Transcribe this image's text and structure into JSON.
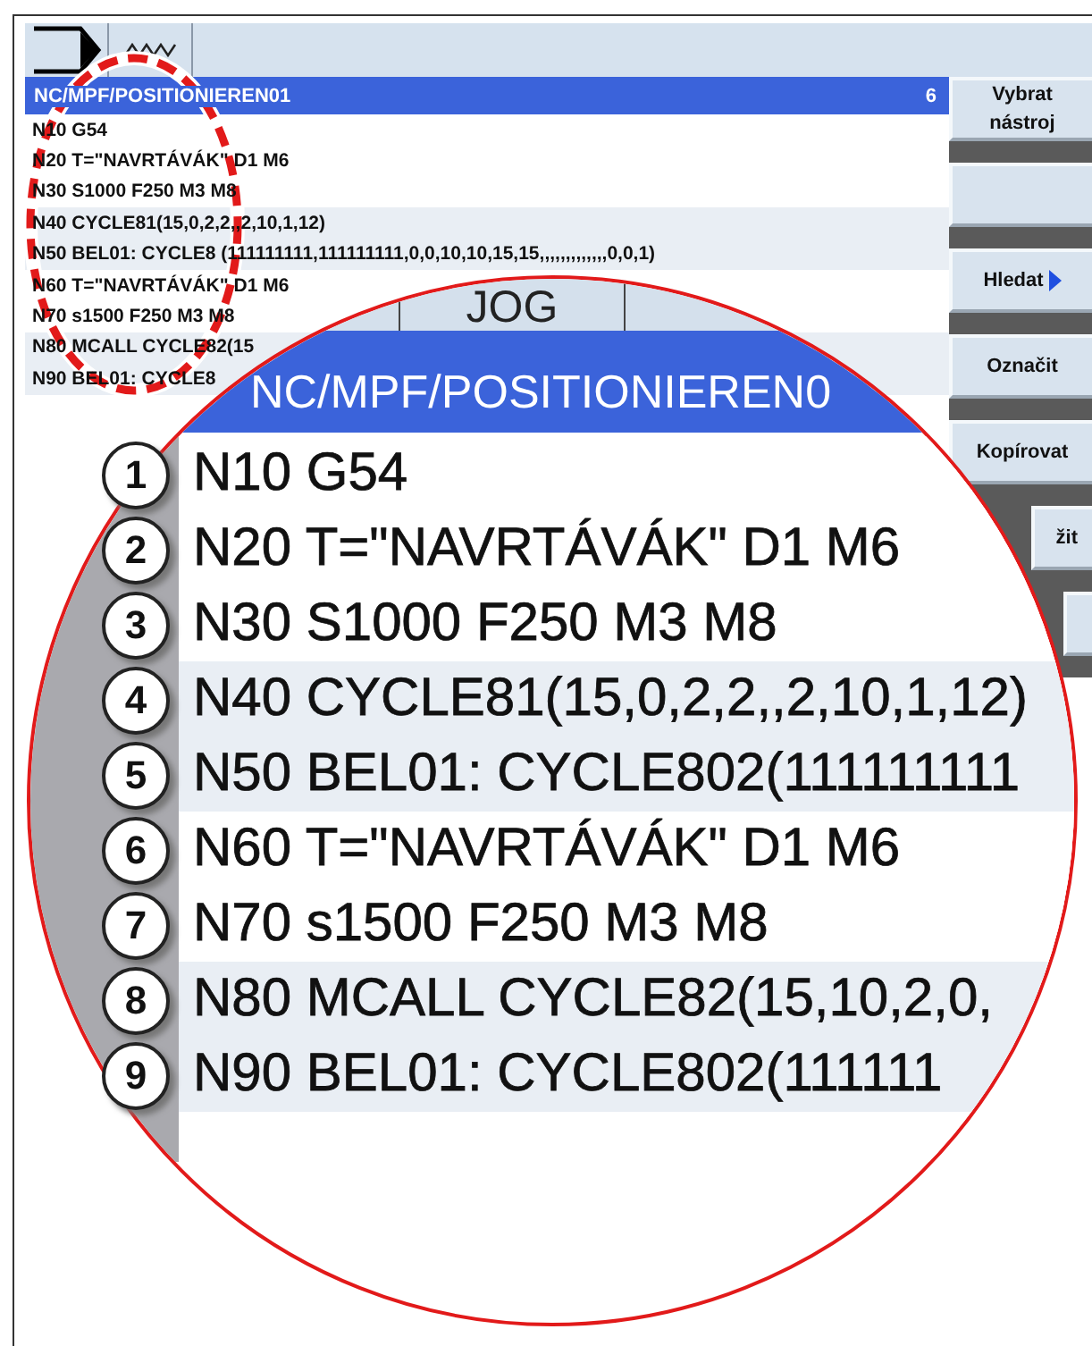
{
  "editor": {
    "title": "NC/MPF/POSITIONIEREN01",
    "line_count": "6",
    "lines": [
      "N10 G54",
      "N20 T=\"NAVRTÁVÁK\" D1 M6",
      "N30 S1000 F250 M3 M8",
      "N40 CYCLE81(15,0,2,2,,2,10,1,12)",
      "N50 BEL01: CYCLE8 (111111111,111111111,0,0,10,10,15,15,,,,,,,,,,,,,0,0,1)",
      "N60 T=\"NAVRTÁVÁK\" D1 M6",
      "N70 s1500 F250 M3 M8",
      "N80 MCALL CYCLE82(15",
      "N90 BEL01: CYCLE8"
    ]
  },
  "softkeys": [
    {
      "kind": "plain",
      "label": "Vybrat nástroj"
    },
    {
      "kind": "plain"
    },
    {
      "kind": "submenu",
      "label": "Hledat"
    },
    {
      "kind": "plain",
      "label": "Označit"
    },
    {
      "kind": "plain",
      "label": "Kopírovat"
    },
    {
      "kind": "partial",
      "label": "žit"
    },
    {
      "kind": "stub"
    }
  ],
  "magnifier": {
    "mode_tab": "JOG",
    "title": "NC/MPF/POSITIONIEREN0",
    "lines": [
      "N10 G54",
      "N20 T=\"NAVRTÁVÁK\" D1 M6",
      "N30 S1000 F250 M3 M8",
      "N40 CYCLE81(15,0,2,2,,2,10,1,12)",
      "N50 BEL01: CYCLE802(111111111",
      "N60 T=\"NAVRTÁVÁK\" D1 M6",
      "N70 s1500 F250 M3 M8",
      "N80 MCALL CYCLE82(15,10,2,0,",
      "N90 BEL01: CYCLE802(111111"
    ]
  },
  "callouts": [
    "1",
    "2",
    "3",
    "4",
    "5",
    "6",
    "7",
    "8",
    "9"
  ]
}
